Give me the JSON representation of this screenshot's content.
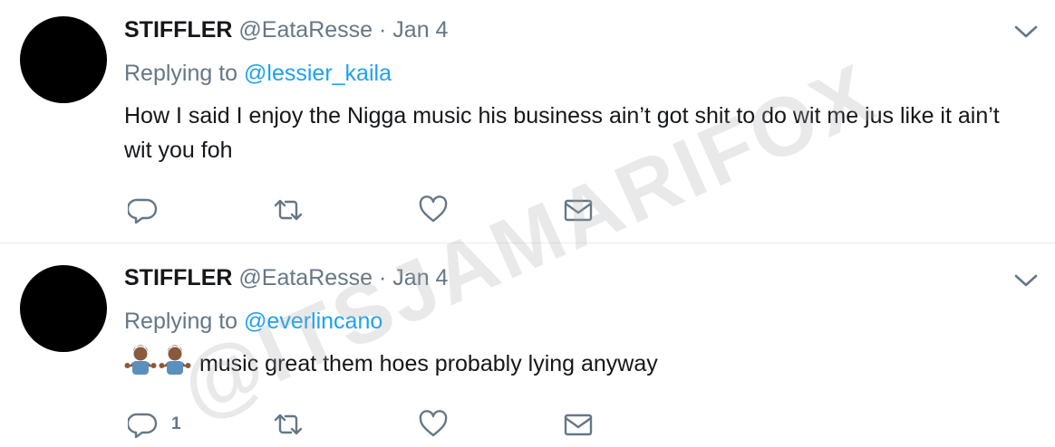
{
  "watermark": "@ITSJAMARIFOX",
  "tweets": [
    {
      "name": "STIFFLER",
      "handle": "@EataResse",
      "separator": "·",
      "date": "Jan 4",
      "replying_prefix": "Replying to",
      "replying_to": "@lessier_kaila",
      "text": "How I said I enjoy the Nigga music his business ain’t got shit to do wit me jus like it ain’t wit you foh",
      "reply_count": "",
      "icons": [
        "reply-icon",
        "retweet-icon",
        "like-icon",
        "direct-message-icon",
        "chevron-down-icon"
      ]
    },
    {
      "name": "STIFFLER",
      "handle": "@EataResse",
      "separator": "·",
      "date": "Jan 4",
      "replying_prefix": "Replying to",
      "replying_to": "@everlincano",
      "text": "music great them hoes probably lying anyway",
      "emojis": [
        "man-shrugging-emoji",
        "man-shrugging-emoji"
      ],
      "reply_count": "1",
      "icons": [
        "reply-icon",
        "retweet-icon",
        "like-icon",
        "direct-message-icon",
        "chevron-down-icon"
      ]
    }
  ],
  "colors": {
    "text": "#14171a",
    "secondary": "#657786",
    "link": "#1da1f2",
    "divider": "#e6ecf0",
    "avatar": "#000000"
  }
}
